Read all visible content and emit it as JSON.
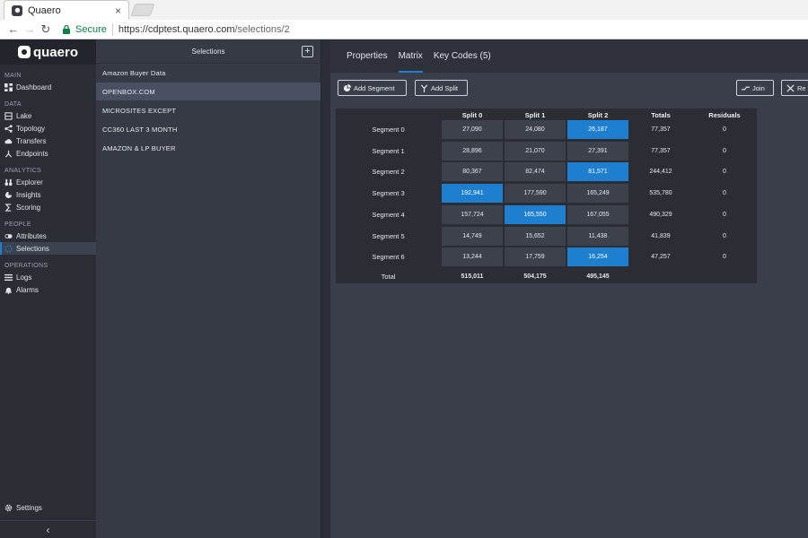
{
  "browser": {
    "tab_title": "Quaero",
    "tab_close": "×",
    "secure_label": "Secure",
    "url_host": "https://cdptest.quaero.com",
    "url_path": "/selections/2"
  },
  "nav": {
    "brand": "quaero",
    "sections": [
      {
        "label": "Main",
        "items": [
          "Dashboard"
        ]
      },
      {
        "label": "Data",
        "items": [
          "Lake",
          "Topology",
          "Transfers",
          "Endpoints"
        ]
      },
      {
        "label": "Analytics",
        "items": [
          "Explorer",
          "Insights",
          "Scoring"
        ]
      },
      {
        "label": "People",
        "items": [
          "Attributes",
          "Selections"
        ]
      },
      {
        "label": "Operations",
        "items": [
          "Logs",
          "Alarms"
        ]
      }
    ],
    "settings": "Settings",
    "collapse": "‹"
  },
  "selections": {
    "header": "Selections",
    "add": "+",
    "items": [
      "Amazon Buyer Data",
      "OPENBOX.COM",
      "MICROSITES EXCEPT",
      "CC360 LAST 3 MONTH",
      "AMAZON & LP BUYER"
    ],
    "active_index": 1
  },
  "main": {
    "tabs": [
      "Properties",
      "Matrix",
      "Key Codes (5)"
    ],
    "active_tab": 1,
    "buttons": {
      "add_segment": "Add Segment",
      "add_split": "Add Split",
      "join": "Join",
      "reset": "Re"
    }
  },
  "matrix": {
    "headers": [
      "Split 0",
      "Split 1",
      "Split 2",
      "Totals",
      "Residuals"
    ],
    "rows": [
      {
        "label": "Segment 0",
        "splits": [
          "27,090",
          "24,080",
          "26,187"
        ],
        "total": "77,357",
        "residual": "0",
        "highlight": 2
      },
      {
        "label": "Segment 1",
        "splits": [
          "28,896",
          "21,070",
          "27,391"
        ],
        "total": "77,357",
        "residual": "0",
        "highlight": -1
      },
      {
        "label": "Segment 2",
        "splits": [
          "80,367",
          "82,474",
          "81,571"
        ],
        "total": "244,412",
        "residual": "0",
        "highlight": 2
      },
      {
        "label": "Segment 3",
        "splits": [
          "192,941",
          "177,590",
          "165,249"
        ],
        "total": "535,780",
        "residual": "0",
        "highlight": 0
      },
      {
        "label": "Segment 4",
        "splits": [
          "157,724",
          "165,550",
          "167,055"
        ],
        "total": "490,329",
        "residual": "0",
        "highlight": 1
      },
      {
        "label": "Segment 5",
        "splits": [
          "14,749",
          "15,652",
          "11,438"
        ],
        "total": "41,839",
        "residual": "0",
        "highlight": -1
      },
      {
        "label": "Segment 6",
        "splits": [
          "13,244",
          "17,759",
          "16,254"
        ],
        "total": "47,257",
        "residual": "0",
        "highlight": 2
      }
    ],
    "total_label": "Total",
    "totals": [
      "515,011",
      "504,175",
      "495,145"
    ]
  },
  "colors": {
    "accent": "#1e7fd0",
    "secure_green": "#0b8043"
  }
}
